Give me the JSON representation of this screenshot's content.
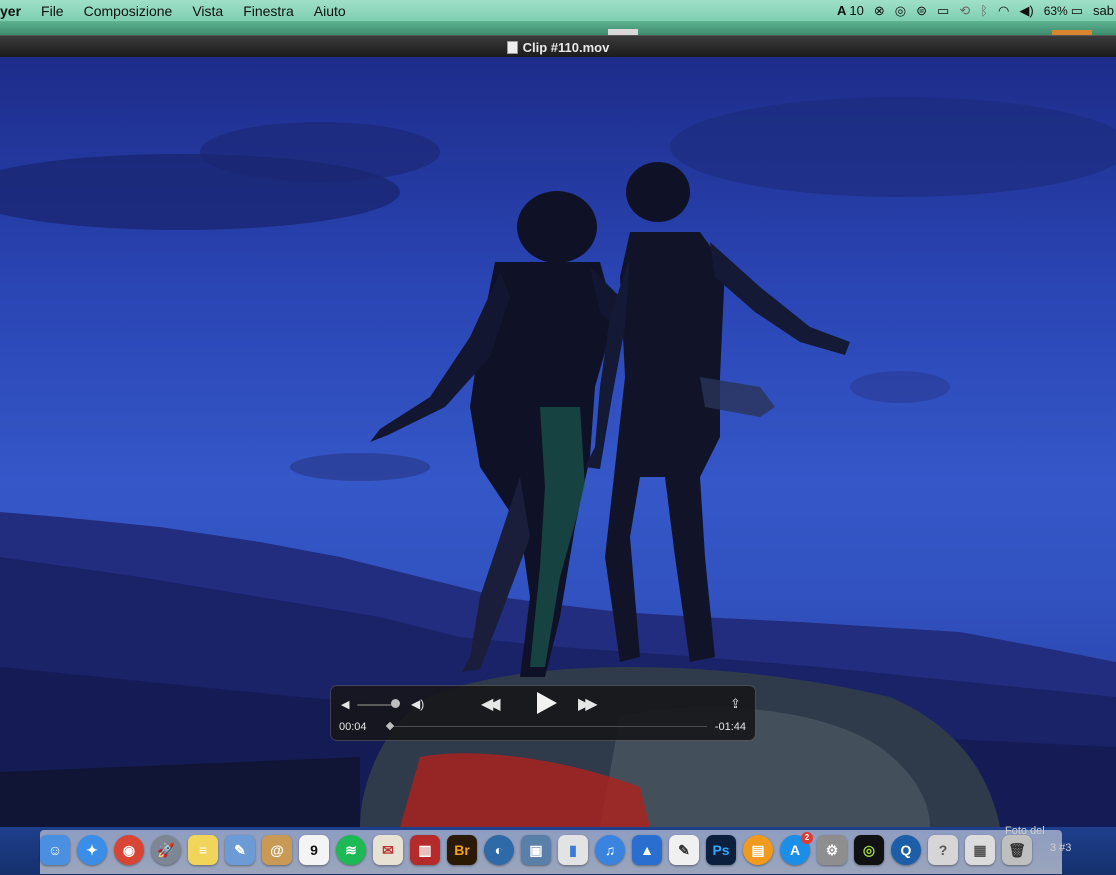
{
  "menubar": {
    "app_name": "yer",
    "items": [
      "File",
      "Composizione",
      "Vista",
      "Finestra",
      "Aiuto"
    ],
    "status": {
      "adobe_count": "10",
      "battery": "63%",
      "user": "sab"
    }
  },
  "window": {
    "title": "Clip #110.mov"
  },
  "player": {
    "current_time": "00:04",
    "remaining_time": "-01:44",
    "volume_level": 0.9,
    "progress": 0.04
  },
  "dock": {
    "icons": [
      {
        "name": "finder-icon",
        "color": "#4a8fe0",
        "glyph": "☺"
      },
      {
        "name": "safari-icon",
        "color": "#3a8ee8",
        "glyph": "✦",
        "round": true
      },
      {
        "name": "chrome-icon",
        "color": "#d94535",
        "glyph": "◉",
        "round": true
      },
      {
        "name": "launchpad-icon",
        "color": "#7d8694",
        "glyph": "🚀",
        "round": true
      },
      {
        "name": "notes-icon",
        "color": "#f1d55a",
        "glyph": "≡"
      },
      {
        "name": "preview-icon",
        "color": "#6d9bd6",
        "glyph": "✎"
      },
      {
        "name": "contacts-icon",
        "color": "#c89a56",
        "glyph": "@"
      },
      {
        "name": "calendar-icon",
        "color": "#f4f4f4",
        "glyph": "9",
        "text_color": "#111"
      },
      {
        "name": "spotify-icon",
        "color": "#1db954",
        "glyph": "≋",
        "round": true
      },
      {
        "name": "photos-app-icon",
        "color": "#e8e2d5",
        "glyph": "✉",
        "text_color": "#b33"
      },
      {
        "name": "photo-booth-icon",
        "color": "#b52a2a",
        "glyph": "▥"
      },
      {
        "name": "bridge-icon",
        "color": "#2a1a05",
        "glyph": "Br",
        "text_color": "#f2a21c"
      },
      {
        "name": "camino-icon",
        "color": "#2f6aa8",
        "glyph": "◐",
        "round": true
      },
      {
        "name": "iphoto-icon",
        "color": "#5a7fa8",
        "glyph": "▣"
      },
      {
        "name": "keynote-chart-icon",
        "color": "#e3e3e3",
        "glyph": "▮",
        "text_color": "#3a7bd5"
      },
      {
        "name": "itunes-icon",
        "color": "#3a84e0",
        "glyph": "♫",
        "round": true
      },
      {
        "name": "keynote-icon",
        "color": "#2a6fd0",
        "glyph": "▲"
      },
      {
        "name": "textedit-icon",
        "color": "#f0f0f0",
        "glyph": "✎",
        "text_color": "#333"
      },
      {
        "name": "photoshop-icon",
        "color": "#0c1f3c",
        "glyph": "Ps",
        "text_color": "#31a8ff"
      },
      {
        "name": "ibooks-icon",
        "color": "#f29a1e",
        "glyph": "▤",
        "round": true
      },
      {
        "name": "app-store-icon",
        "color": "#1b8fe8",
        "glyph": "A",
        "round": true,
        "badge": "2"
      },
      {
        "name": "system-preferences-icon",
        "color": "#8e8e8e",
        "glyph": "⚙"
      },
      {
        "name": "activity-monitor-icon",
        "color": "#111",
        "glyph": "◎",
        "text_color": "#9fd050"
      },
      {
        "name": "quicktime-icon",
        "color": "#1c5ea8",
        "glyph": "Q",
        "round": true
      },
      {
        "name": "help-icon",
        "color": "#d6d6d6",
        "glyph": "?",
        "text_color": "#555"
      },
      {
        "name": "photo-folder-icon",
        "color": "#dcdcdc",
        "glyph": "▦",
        "text_color": "#555"
      },
      {
        "name": "trash-icon",
        "color": "#bfbfbf",
        "glyph": "🗑",
        "text_color": "#333"
      }
    ],
    "label_line1": "Foto del",
    "label_line2": "3 #3"
  }
}
